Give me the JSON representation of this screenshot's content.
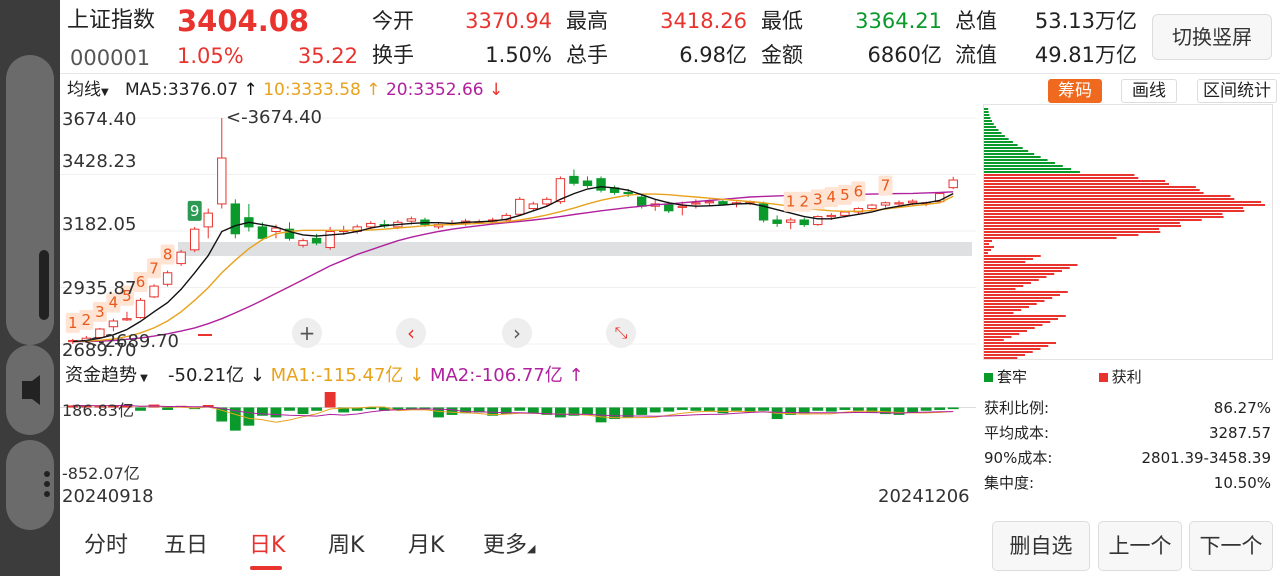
{
  "header": {
    "name": "上证指数",
    "price": "3404.08",
    "code": "000001",
    "change_pct": "1.05%",
    "change_abs": "35.22",
    "open_label": "今开",
    "open_value": "3370.94",
    "high_label": "最高",
    "high_value": "3418.26",
    "low_label": "最低",
    "low_value": "3364.21",
    "total_value_label": "总值",
    "total_value": "53.13万亿",
    "turnover_label": "换手",
    "turnover_value": "1.50%",
    "volume_label": "总手",
    "volume_value": "6.98亿",
    "amount_label": "金额",
    "amount_value": "6860亿",
    "float_value_label": "流值",
    "float_value": "49.81万亿",
    "switch_button": "切换竖屏"
  },
  "toolbar": {
    "indicator_select": "均线",
    "ma5": "MA5:3376.07",
    "ma10": "10:3333.58",
    "ma20": "20:3352.66",
    "chips_button": "筹码",
    "draw_button": "画线",
    "range_button": "区间统计"
  },
  "price_axis": {
    "ticks": [
      "3674.40",
      "3428.23",
      "3182.05",
      "2935.87",
      "2689.70"
    ],
    "max_label": "<-3674.40",
    "min_label": "<-2689.70"
  },
  "tick_counter": [
    "1",
    "2",
    "3",
    "4",
    "5",
    "6",
    "7",
    "8",
    "9",
    "1",
    "2",
    "3",
    "4",
    "5",
    "6",
    "7"
  ],
  "funds": {
    "indicator_select": "资金趋势",
    "value": "-50.21亿",
    "ma1": "MA1:-115.47亿",
    "ma2": "MA2:-106.77亿",
    "axis_top": "186.83亿",
    "axis_bottom": "-852.07亿"
  },
  "dates": {
    "start": "20240918",
    "end": "20241206"
  },
  "chips": {
    "legend_trapped": "套牢",
    "legend_profit": "获利",
    "stats": [
      {
        "label": "获利比例:",
        "value": "86.27%"
      },
      {
        "label": "平均成本:",
        "value": "3287.57"
      },
      {
        "label": "90%成本:",
        "value": "2801.39-3458.39"
      },
      {
        "label": "集中度:",
        "value": "10.50%"
      }
    ]
  },
  "tabs": [
    "分时",
    "五日",
    "日K",
    "周K",
    "月K",
    "更多"
  ],
  "active_tab": "日K",
  "actions": {
    "remove": "删自选",
    "prev": "上一个",
    "next": "下一个"
  },
  "colors": {
    "up": "#e8332e",
    "down": "#0a9a2c",
    "ma5": "#111111",
    "ma10": "#e8a21c",
    "ma20": "#b0219e",
    "chips_active": "#ef6a1f"
  },
  "chart_data": {
    "type": "candlestick",
    "x_start": "20240918",
    "x_end": "20241206",
    "ylim": [
      2689.7,
      3674.4
    ],
    "candles": [
      {
        "o": 2700,
        "h": 2712,
        "l": 2689.7,
        "c": 2705
      },
      {
        "o": 2705,
        "h": 2725,
        "l": 2695,
        "c": 2715
      },
      {
        "o": 2718,
        "h": 2760,
        "l": 2712,
        "c": 2755
      },
      {
        "o": 2765,
        "h": 2800,
        "l": 2745,
        "c": 2790
      },
      {
        "o": 2800,
        "h": 2830,
        "l": 2790,
        "c": 2800
      },
      {
        "o": 2805,
        "h": 2890,
        "l": 2800,
        "c": 2880
      },
      {
        "o": 2895,
        "h": 2950,
        "l": 2890,
        "c": 2942
      },
      {
        "o": 2950,
        "h": 3010,
        "l": 2940,
        "c": 3000
      },
      {
        "o": 3040,
        "h": 3100,
        "l": 3030,
        "c": 3090
      },
      {
        "o": 3100,
        "h": 3200,
        "l": 3090,
        "c": 3190
      },
      {
        "o": 3200,
        "h": 3280,
        "l": 3150,
        "c": 3260
      },
      {
        "o": 3300,
        "h": 3674.4,
        "l": 3280,
        "c": 3500
      },
      {
        "o": 3300,
        "h": 3320,
        "l": 3150,
        "c": 3170
      },
      {
        "o": 3240,
        "h": 3300,
        "l": 3180,
        "c": 3200
      },
      {
        "o": 3200,
        "h": 3220,
        "l": 3140,
        "c": 3150
      },
      {
        "o": 3180,
        "h": 3210,
        "l": 3150,
        "c": 3195
      },
      {
        "o": 3190,
        "h": 3220,
        "l": 3140,
        "c": 3150
      },
      {
        "o": 3120,
        "h": 3150,
        "l": 3110,
        "c": 3140
      },
      {
        "o": 3150,
        "h": 3170,
        "l": 3120,
        "c": 3130
      },
      {
        "o": 3110,
        "h": 3200,
        "l": 3100,
        "c": 3180
      },
      {
        "o": 3180,
        "h": 3205,
        "l": 3165,
        "c": 3185
      },
      {
        "o": 3180,
        "h": 3210,
        "l": 3170,
        "c": 3200
      },
      {
        "o": 3200,
        "h": 3225,
        "l": 3190,
        "c": 3215
      },
      {
        "o": 3210,
        "h": 3230,
        "l": 3195,
        "c": 3205
      },
      {
        "o": 3200,
        "h": 3230,
        "l": 3190,
        "c": 3220
      },
      {
        "o": 3225,
        "h": 3245,
        "l": 3210,
        "c": 3235
      },
      {
        "o": 3230,
        "h": 3240,
        "l": 3200,
        "c": 3210
      },
      {
        "o": 3200,
        "h": 3220,
        "l": 3190,
        "c": 3210
      },
      {
        "o": 3210,
        "h": 3230,
        "l": 3205,
        "c": 3215
      },
      {
        "o": 3215,
        "h": 3235,
        "l": 3205,
        "c": 3225
      },
      {
        "o": 3220,
        "h": 3232,
        "l": 3212,
        "c": 3222
      },
      {
        "o": 3225,
        "h": 3240,
        "l": 3215,
        "c": 3230
      },
      {
        "o": 3230,
        "h": 3260,
        "l": 3225,
        "c": 3250
      },
      {
        "o": 3255,
        "h": 3330,
        "l": 3250,
        "c": 3320
      },
      {
        "o": 3280,
        "h": 3310,
        "l": 3270,
        "c": 3300
      },
      {
        "o": 3300,
        "h": 3330,
        "l": 3290,
        "c": 3320
      },
      {
        "o": 3310,
        "h": 3420,
        "l": 3300,
        "c": 3410
      },
      {
        "o": 3420,
        "h": 3450,
        "l": 3380,
        "c": 3390
      },
      {
        "o": 3400,
        "h": 3420,
        "l": 3370,
        "c": 3380
      },
      {
        "o": 3410,
        "h": 3420,
        "l": 3350,
        "c": 3360
      },
      {
        "o": 3370,
        "h": 3380,
        "l": 3340,
        "c": 3350
      },
      {
        "o": 3350,
        "h": 3365,
        "l": 3330,
        "c": 3345
      },
      {
        "o": 3330,
        "h": 3340,
        "l": 3280,
        "c": 3290
      },
      {
        "o": 3290,
        "h": 3320,
        "l": 3270,
        "c": 3300
      },
      {
        "o": 3300,
        "h": 3310,
        "l": 3260,
        "c": 3270
      },
      {
        "o": 3290,
        "h": 3310,
        "l": 3250,
        "c": 3290
      },
      {
        "o": 3300,
        "h": 3320,
        "l": 3280,
        "c": 3305
      },
      {
        "o": 3305,
        "h": 3320,
        "l": 3290,
        "c": 3310
      },
      {
        "o": 3310,
        "h": 3320,
        "l": 3295,
        "c": 3300
      },
      {
        "o": 3300,
        "h": 3310,
        "l": 3285,
        "c": 3305
      },
      {
        "o": 3305,
        "h": 3315,
        "l": 3295,
        "c": 3310
      },
      {
        "o": 3300,
        "h": 3310,
        "l": 3220,
        "c": 3230
      },
      {
        "o": 3230,
        "h": 3250,
        "l": 3200,
        "c": 3215
      },
      {
        "o": 3220,
        "h": 3240,
        "l": 3190,
        "c": 3230
      },
      {
        "o": 3230,
        "h": 3240,
        "l": 3200,
        "c": 3210
      },
      {
        "o": 3210,
        "h": 3250,
        "l": 3205,
        "c": 3245
      },
      {
        "o": 3245,
        "h": 3260,
        "l": 3230,
        "c": 3250
      },
      {
        "o": 3250,
        "h": 3270,
        "l": 3240,
        "c": 3265
      },
      {
        "o": 3265,
        "h": 3285,
        "l": 3255,
        "c": 3280
      },
      {
        "o": 3280,
        "h": 3300,
        "l": 3270,
        "c": 3295
      },
      {
        "o": 3295,
        "h": 3310,
        "l": 3285,
        "c": 3305
      },
      {
        "o": 3300,
        "h": 3315,
        "l": 3290,
        "c": 3305
      },
      {
        "o": 3305,
        "h": 3320,
        "l": 3295,
        "c": 3312
      },
      {
        "o": 3300,
        "h": 3310,
        "l": 3290,
        "c": 3305
      },
      {
        "o": 3310,
        "h": 3350,
        "l": 3305,
        "c": 3345
      },
      {
        "o": 3370.94,
        "h": 3418.26,
        "l": 3364.21,
        "c": 3404.08
      }
    ],
    "ma5": [
      2700,
      2705,
      2715,
      2730,
      2753,
      2788,
      2830,
      2870,
      2928,
      3000,
      3075,
      3180,
      3205,
      3220,
      3210,
      3200,
      3180,
      3165,
      3160,
      3165,
      3170,
      3180,
      3195,
      3205,
      3210,
      3215,
      3218,
      3218,
      3215,
      3220,
      3222,
      3225,
      3233,
      3250,
      3270,
      3290,
      3320,
      3345,
      3365,
      3375,
      3370,
      3360,
      3340,
      3320,
      3305,
      3295,
      3290,
      3292,
      3295,
      3300,
      3302,
      3290,
      3275,
      3260,
      3245,
      3235,
      3235,
      3245,
      3255,
      3265,
      3280,
      3290,
      3300,
      3305,
      3315,
      3345
    ],
    "ma10": [
      2700,
      2702,
      2706,
      2712,
      2722,
      2738,
      2760,
      2790,
      2830,
      2880,
      2935,
      3000,
      3055,
      3105,
      3145,
      3170,
      3180,
      3185,
      3185,
      3185,
      3185,
      3185,
      3187,
      3190,
      3195,
      3200,
      3205,
      3208,
      3210,
      3212,
      3215,
      3218,
      3222,
      3230,
      3240,
      3252,
      3266,
      3282,
      3300,
      3316,
      3328,
      3338,
      3343,
      3343,
      3340,
      3335,
      3330,
      3325,
      3320,
      3315,
      3310,
      3305,
      3298,
      3290,
      3282,
      3275,
      3270,
      3268,
      3268,
      3272,
      3278,
      3285,
      3292,
      3298,
      3305,
      3333.58
    ],
    "ma20": [
      2700,
      2700,
      2702,
      2705,
      2710,
      2716,
      2724,
      2734,
      2746,
      2760,
      2778,
      2800,
      2825,
      2852,
      2880,
      2910,
      2940,
      2970,
      3000,
      3030,
      3055,
      3080,
      3100,
      3120,
      3140,
      3155,
      3168,
      3180,
      3190,
      3198,
      3205,
      3212,
      3218,
      3224,
      3230,
      3237,
      3245,
      3254,
      3262,
      3270,
      3277,
      3284,
      3290,
      3296,
      3300,
      3305,
      3310,
      3315,
      3320,
      3325,
      3330,
      3333,
      3335,
      3337,
      3338,
      3339,
      3340,
      3341,
      3342,
      3343,
      3344,
      3345,
      3346,
      3348,
      3350,
      3352.66
    ],
    "fund_flow": [
      25,
      20,
      15,
      30,
      35,
      -40,
      35,
      -30,
      20,
      -20,
      30,
      -170,
      -280,
      -220,
      -100,
      -120,
      -40,
      -80,
      -40,
      186.83,
      -60,
      -40,
      -20,
      -40,
      -30,
      -20,
      -25,
      -120,
      -90,
      -70,
      -60,
      -100,
      -80,
      -40,
      -70,
      -90,
      -120,
      -100,
      -80,
      -180,
      -140,
      -120,
      -90,
      -60,
      -50,
      -30,
      -40,
      -50,
      -70,
      -40,
      -60,
      -40,
      -140,
      -90,
      -70,
      -40,
      -50,
      -30,
      -40,
      -60,
      -80,
      -90,
      -60,
      -40,
      -30,
      -20
    ],
    "fund_ylim": [
      -852.07,
      186.83
    ]
  }
}
